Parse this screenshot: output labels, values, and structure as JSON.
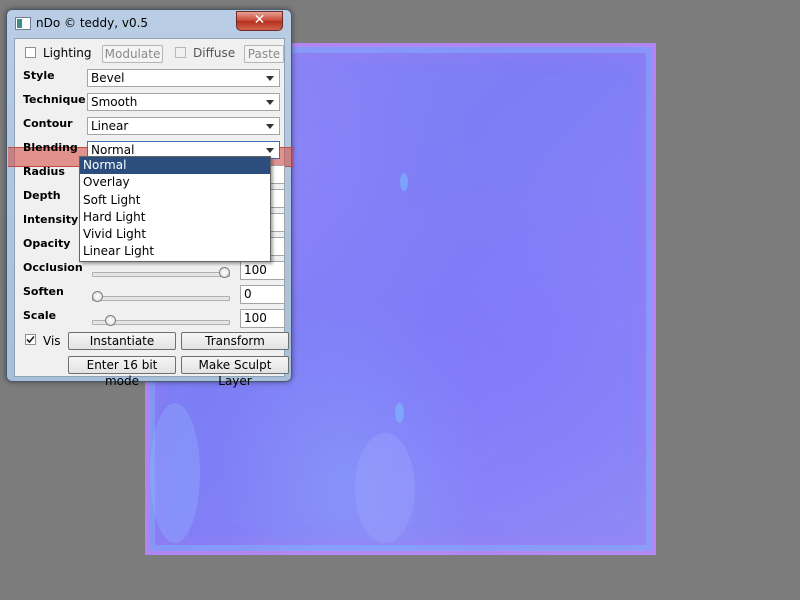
{
  "window": {
    "title": "nDo © teddy, v0.5",
    "close_label": "✕"
  },
  "toolbar": {
    "lighting_label": "Lighting",
    "lighting_checked": false,
    "modulate_label": "Modulate",
    "diffuse_label": "Diffuse",
    "diffuse_checked": false,
    "paste_label": "Paste"
  },
  "fields": {
    "style": {
      "label": "Style",
      "value": "Bevel"
    },
    "technique": {
      "label": "Technique",
      "value": "Smooth"
    },
    "contour": {
      "label": "Contour",
      "value": "Linear"
    },
    "blending": {
      "label": "Blending",
      "value": "Normal"
    }
  },
  "sliders": {
    "radius": {
      "label": "Radius"
    },
    "depth": {
      "label": "Depth"
    },
    "intensity": {
      "label": "Intensity"
    },
    "opacity": {
      "label": "Opacity"
    },
    "occlusion": {
      "label": "Occlusion",
      "value": "100",
      "level": 1.0
    },
    "soften": {
      "label": "Soften",
      "value": "0",
      "level": 0.0
    },
    "scale": {
      "label": "Scale",
      "value": "100",
      "level": 0.1
    }
  },
  "blending_options": [
    "Normal",
    "Overlay",
    "Soft Light",
    "Hard Light",
    "Vivid Light",
    "Linear Light"
  ],
  "bottom": {
    "vis_label": "Vis",
    "vis_checked": true,
    "instantiate_label": "Instantiate",
    "transform_label": "Transform",
    "bit_mode_label": "Enter 16 bit mode",
    "sculpt_label": "Make Sculpt Layer"
  }
}
